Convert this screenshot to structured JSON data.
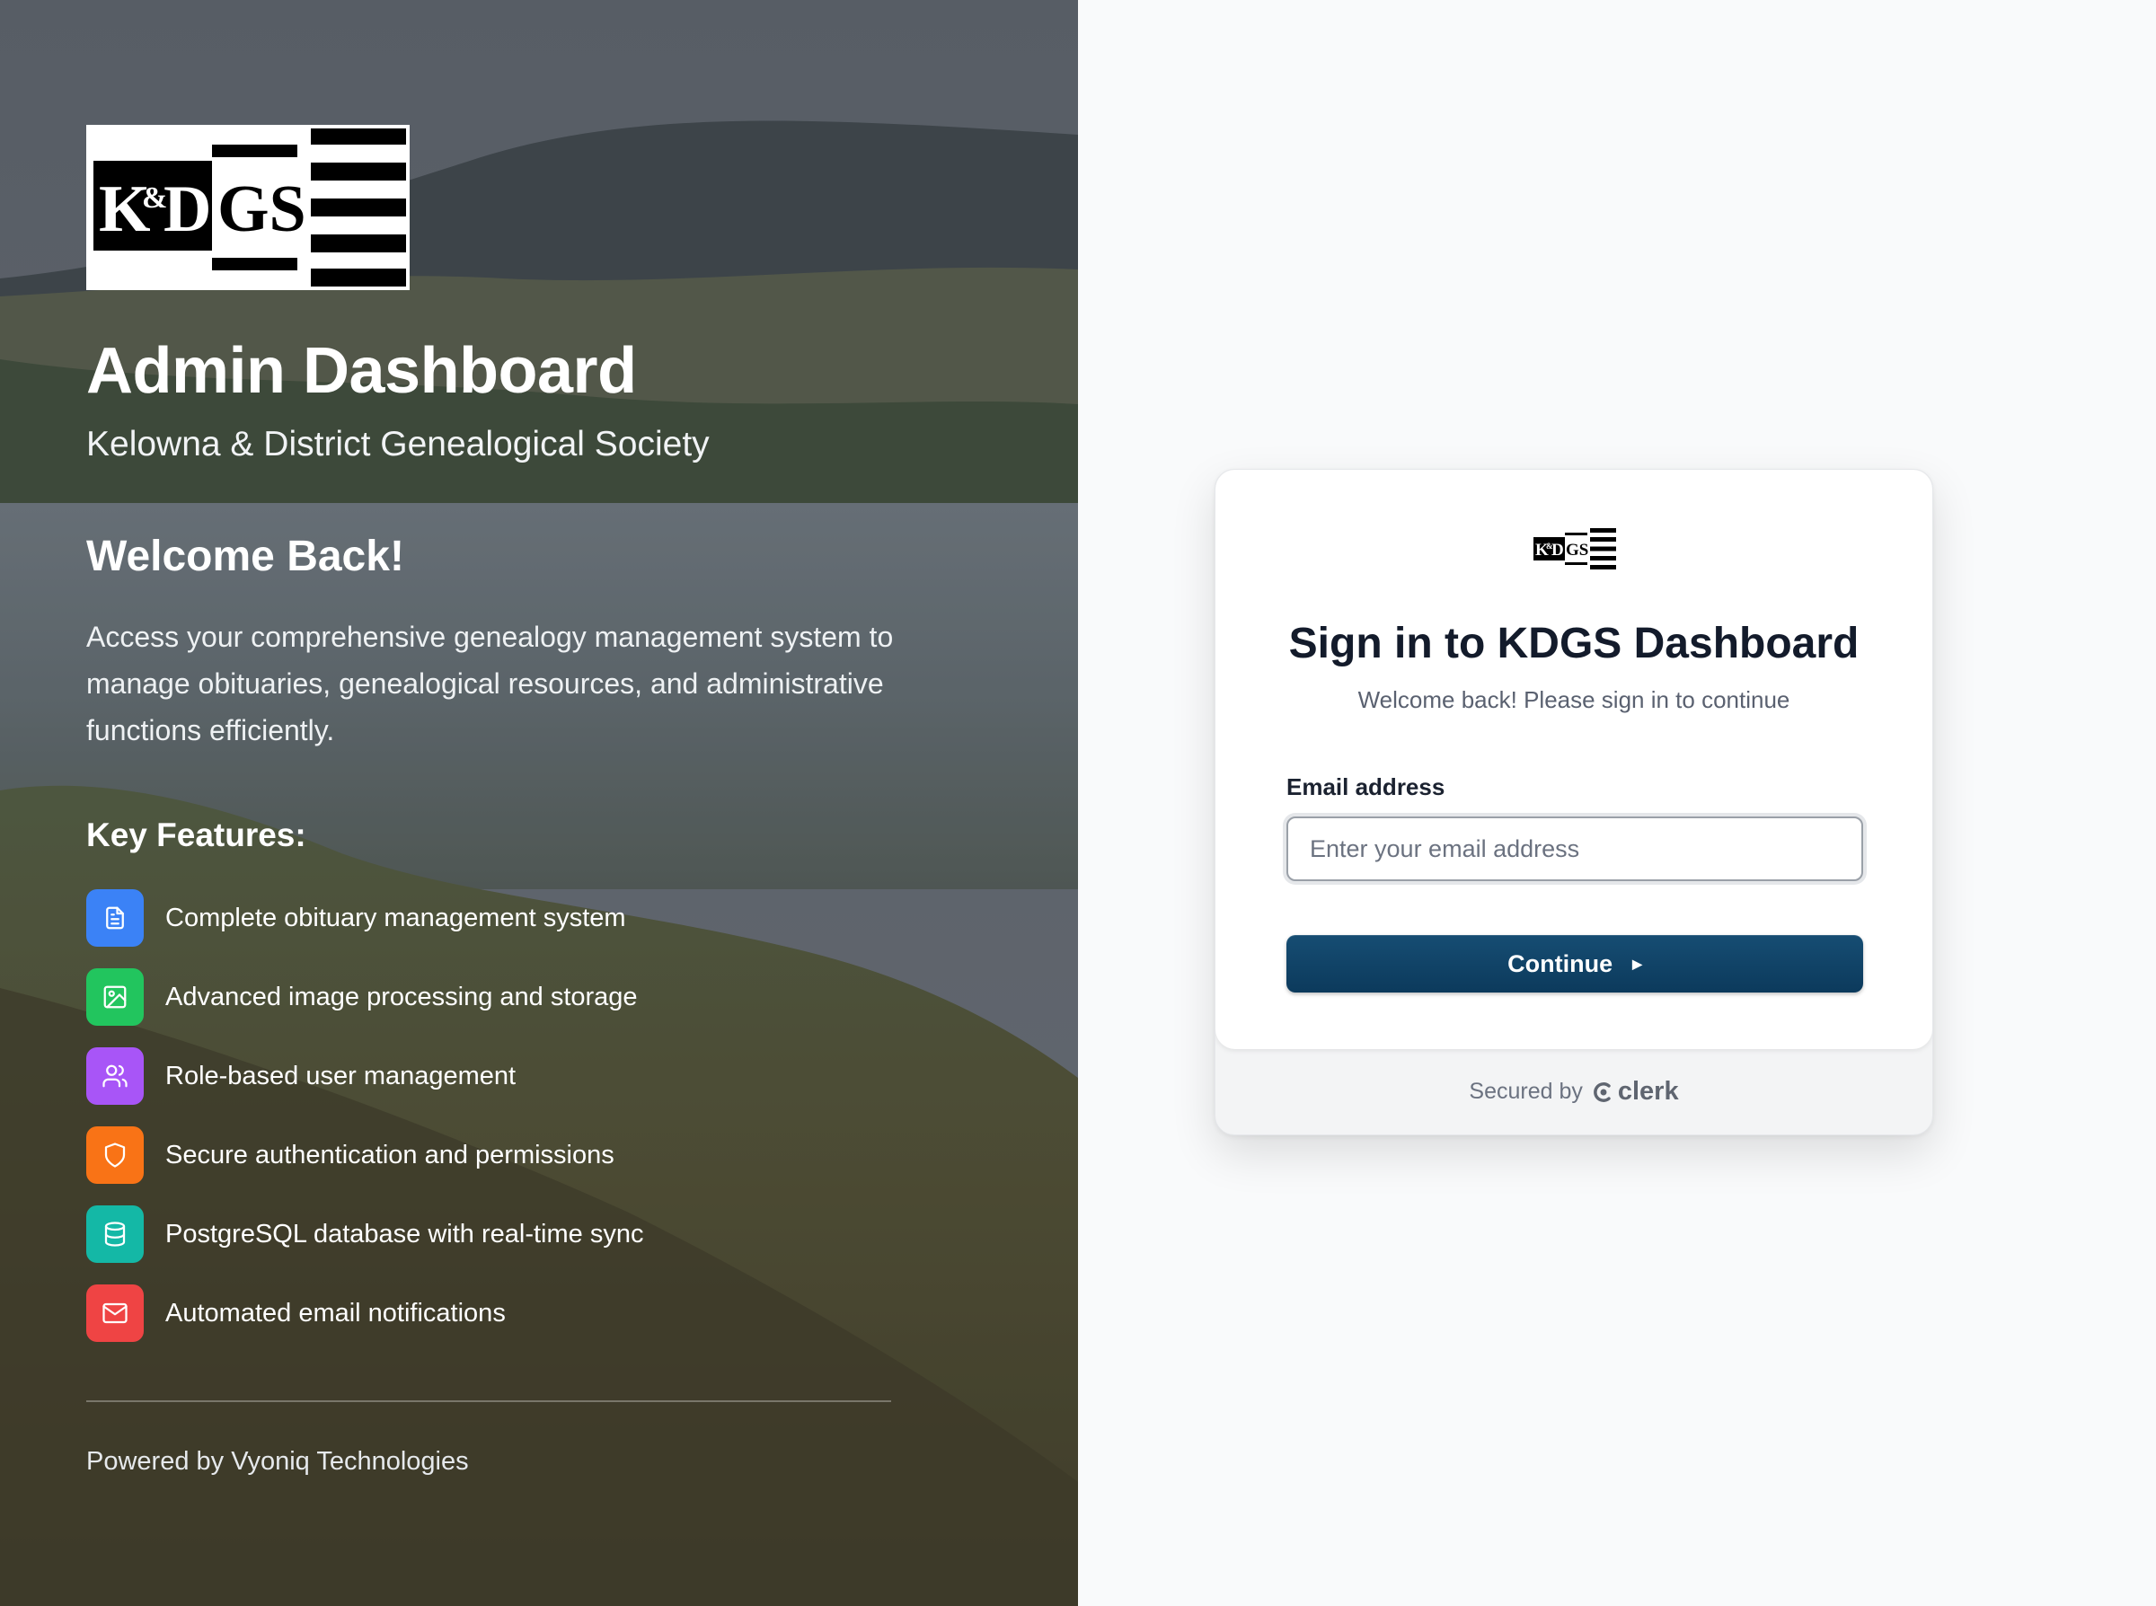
{
  "hero": {
    "logo_text": "K&DGS",
    "title": "Admin Dashboard",
    "subtitle": "Kelowna & District Genealogical Society",
    "welcome": "Welcome Back!",
    "intro": "Access your comprehensive genealogy management system to manage obituaries, genealogical resources, and administrative functions efficiently.",
    "features_title": "Key Features:",
    "features": [
      {
        "label": "Complete obituary management system",
        "icon": "document-icon",
        "color": "#3b82f6"
      },
      {
        "label": "Advanced image processing and storage",
        "icon": "image-icon",
        "color": "#22c55e"
      },
      {
        "label": "Role-based user management",
        "icon": "users-icon",
        "color": "#a855f7"
      },
      {
        "label": "Secure authentication and permissions",
        "icon": "shield-icon",
        "color": "#f97316"
      },
      {
        "label": "PostgreSQL database with real-time sync",
        "icon": "database-icon",
        "color": "#14b8a6"
      },
      {
        "label": "Automated email notifications",
        "icon": "mail-icon",
        "color": "#ef4444"
      }
    ],
    "powered_by": "Powered by Vyoniq Technologies"
  },
  "signin": {
    "title": "Sign in to KDGS Dashboard",
    "subtitle": "Welcome back! Please sign in to continue",
    "email_label": "Email address",
    "email_placeholder": "Enter your email address",
    "email_value": "",
    "continue_label": "Continue",
    "secured_by": "Secured by",
    "provider": "clerk"
  },
  "colors": {
    "button_primary": "#0f4265",
    "page_background": "#f9fafb"
  }
}
